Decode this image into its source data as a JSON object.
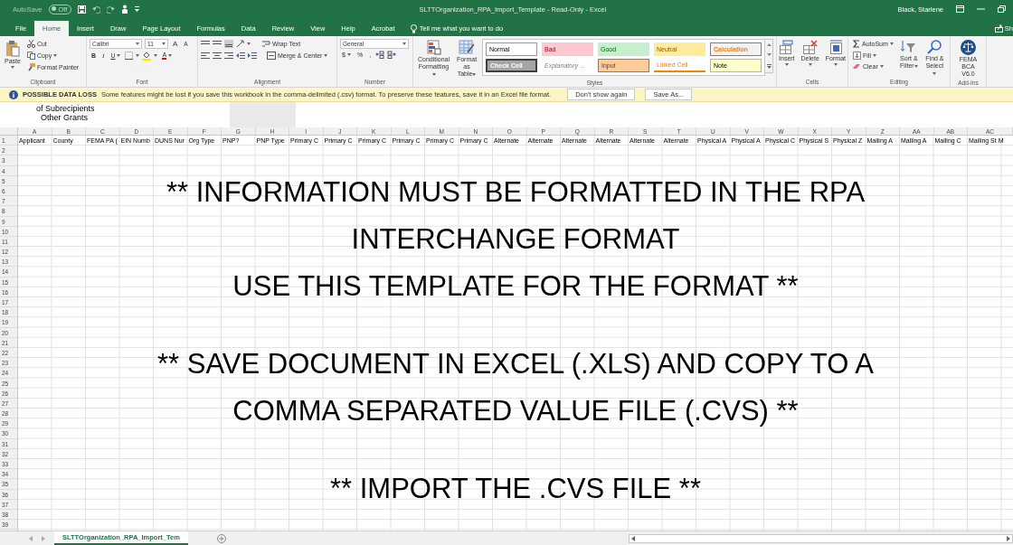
{
  "window": {
    "title": "SLTTOrganization_RPA_Import_Template  -  Read-Only  -  Excel",
    "user": "Black, Starlene",
    "autosave": {
      "label": "AutoSave",
      "state": "Off",
      "on": false
    }
  },
  "ribbon_tabs": [
    {
      "label": "File",
      "selected": false
    },
    {
      "label": "Home",
      "selected": true
    },
    {
      "label": "Insert",
      "selected": false
    },
    {
      "label": "Draw",
      "selected": false
    },
    {
      "label": "Page Layout",
      "selected": false
    },
    {
      "label": "Formulas",
      "selected": false
    },
    {
      "label": "Data",
      "selected": false
    },
    {
      "label": "Review",
      "selected": false
    },
    {
      "label": "View",
      "selected": false
    },
    {
      "label": "Help",
      "selected": false
    },
    {
      "label": "Acrobat",
      "selected": false
    }
  ],
  "tell_me": {
    "placeholder": "Tell me what you want to do"
  },
  "share": "Sh",
  "ribbon": {
    "clipboard": {
      "paste": "Paste",
      "cut": "Cut",
      "copy": "Copy",
      "format_painter": "Format Painter",
      "label": "Clipboard"
    },
    "font": {
      "name": "Calibri",
      "size": "11",
      "grow": "A",
      "shrink": "A",
      "bold": "B",
      "italic": "I",
      "underline": "U",
      "font_color": "A",
      "label": "Font"
    },
    "alignment": {
      "wrap_text": "Wrap Text",
      "merge_center": "Merge & Center",
      "label": "Alignment"
    },
    "number": {
      "format": "General",
      "currency": "$",
      "percent": "%",
      "comma": ",",
      "label": "Number"
    },
    "styles": {
      "conditional_formatting": "Conditional Formatting",
      "format_as_table": "Format as Table",
      "label": "Styles",
      "cell_styles": [
        {
          "label": "Normal",
          "kind": "normal"
        },
        {
          "label": "Bad",
          "kind": "bad"
        },
        {
          "label": "Good",
          "kind": "good"
        },
        {
          "label": "Neutral",
          "kind": "neutral"
        },
        {
          "label": "Calculation",
          "kind": "calculation"
        },
        {
          "label": "Check Cell",
          "kind": "check"
        },
        {
          "label": "Explanatory ...",
          "kind": "explanatory"
        },
        {
          "label": "Input",
          "kind": "input"
        },
        {
          "label": "Linked Cell",
          "kind": "linked"
        },
        {
          "label": "Note",
          "kind": "note"
        }
      ]
    },
    "cells": {
      "buttons": [
        "Insert",
        "Delete",
        "Format"
      ],
      "label": "Cells"
    },
    "editing": {
      "autosum": "AutoSum",
      "fill": "Fill",
      "clear": "Clear",
      "sort_filter": "Sort & Filter",
      "find_select": "Find & Select",
      "label": "Editing"
    },
    "add_ins": {
      "button": "FEMA BCA V6.0",
      "label": "Add-Ins"
    }
  },
  "message_bar": {
    "title": "POSSIBLE DATA LOSS",
    "text": "Some features might be lost if you save this workbook in the comma-delimited (.csv) format. To preserve these features, save it in an Excel file format.",
    "buttons": [
      "Don't show again",
      "Save As..."
    ]
  },
  "text_box_fragment": [
    "of Subrecipients",
    "Other Grants"
  ],
  "sheet": {
    "columns": [
      "A",
      "B",
      "C",
      "D",
      "E",
      "F",
      "G",
      "H",
      "I",
      "J",
      "K",
      "L",
      "M",
      "N",
      "O",
      "P",
      "Q",
      "R",
      "S",
      "T",
      "U",
      "V",
      "W",
      "X",
      "Y",
      "Z",
      "AA",
      "AB",
      "AC"
    ],
    "rows": [
      "1",
      "2",
      "3",
      "4",
      "5",
      "6",
      "7",
      "8",
      "9",
      "10",
      "11",
      "12",
      "13",
      "14",
      "15",
      "16",
      "17",
      "18",
      "19",
      "20",
      "21",
      "22",
      "23",
      "24",
      "25",
      "26",
      "27",
      "28",
      "29",
      "30",
      "31",
      "32",
      "33",
      "34",
      "35",
      "36",
      "37",
      "38",
      "39"
    ],
    "header_cells": [
      "Applicant",
      "County",
      "FEMA PA (",
      "EIN Numb",
      "DUNS Nur",
      "Org Type",
      "PNP?",
      "PNP Type",
      "Primary C",
      "Primary C",
      "Primary C",
      "Primary C",
      "Primary C",
      "Primary C",
      "Alternate",
      "Alternate",
      "Alternate",
      "Alternate",
      "Alternate",
      "Alternate",
      "Physical A",
      "Physical A",
      "Physical C",
      "Physical S",
      "Physical Z",
      "Mailing A",
      "Mailing A",
      "Mailing C",
      "Mailing St M"
    ],
    "notice": [
      [
        "** INFORMATION MUST BE FORMATTED IN THE RPA",
        "INTERCHANGE FORMAT",
        "USE THIS TEMPLATE FOR THE FORMAT **"
      ],
      [
        "** SAVE DOCUMENT IN EXCEL (.XLS) AND COPY TO A",
        "COMMA SEPARATED VALUE FILE (.CVS) **"
      ],
      [
        "** IMPORT THE .CVS FILE **"
      ]
    ]
  },
  "sheet_tabs": [
    {
      "label": "SLTTOrganization_RPA_Import_Tem",
      "selected": true
    }
  ]
}
